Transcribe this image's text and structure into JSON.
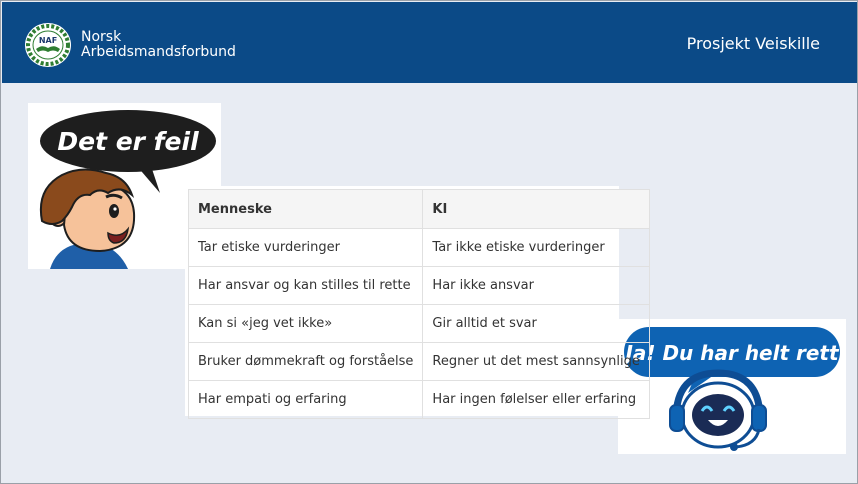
{
  "header": {
    "logo_text": "NAF",
    "org_line1": "Norsk",
    "org_line2": "Arbeidsmandsforbund",
    "project_title": "Prosjekt Veiskille"
  },
  "images": {
    "boy_bubble": "Det er feil",
    "robot_bubble": "Ja! Du har helt rett"
  },
  "table": {
    "headers": [
      "Menneske",
      "KI"
    ],
    "rows": [
      [
        "Tar etiske vurderinger",
        "Tar ikke etiske vurderinger"
      ],
      [
        "Har ansvar og kan stilles til rette",
        "Har ikke ansvar"
      ],
      [
        "Kan si «jeg vet ikke»",
        "Gir alltid et svar"
      ],
      [
        "Bruker dømmekraft og forståelse",
        "Regner ut det mest sannsynlige"
      ],
      [
        "Har empati og erfaring",
        "Har ingen følelser eller erfaring"
      ]
    ]
  },
  "colors": {
    "header_bg": "#0b4a87",
    "page_bg": "#e8ecf3",
    "bubble_dark": "#1e1e1e",
    "bubble_blue": "#0e63b3"
  }
}
